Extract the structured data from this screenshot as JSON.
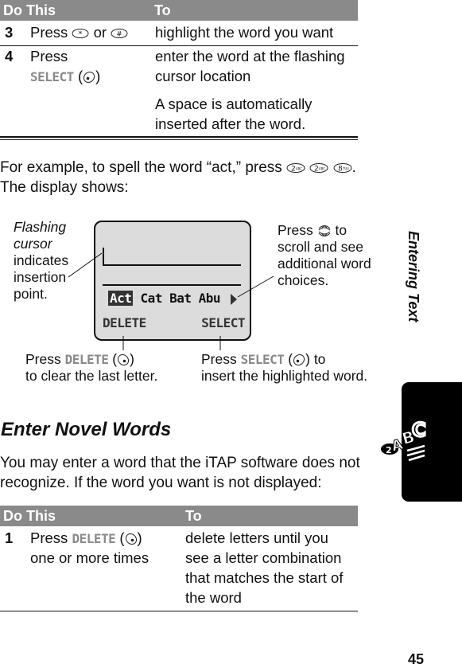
{
  "table1": {
    "header": {
      "col1": "Do This",
      "col2": "To"
    },
    "rows": [
      {
        "num": "3",
        "action_pre": "Press",
        "action_mid": "or",
        "key1_icon": "star-key-icon",
        "key2_icon": "pound-key-icon",
        "result": "highlight the word you want"
      },
      {
        "num": "4",
        "action_line1": "Press",
        "action_key": "SELECT",
        "key_icon": "select-softkey-icon",
        "result_line1": "enter the word at the flashing",
        "result_line2": "cursor location",
        "note_line1": "A space is automatically",
        "note_line2": "inserted after the word."
      }
    ]
  },
  "example": {
    "line1": "For example, to spell the word “act,” press",
    "keys": [
      "2abc",
      "2abc",
      "8tuv"
    ],
    "period": ".",
    "line2": "The display shows:"
  },
  "display": {
    "words": [
      "Act",
      "Cat",
      "Bat",
      "Abu"
    ],
    "selected_word": "Act",
    "left_softkey": "DELETE",
    "right_softkey": "SELECT",
    "more_arrow_icon": "right-triangle-icon"
  },
  "callouts": {
    "cursor": {
      "line1": "Flashing",
      "line2": "cursor",
      "line3": "indicates",
      "line4": "insertion",
      "line5": "point."
    },
    "scroll": {
      "pre": "Press",
      "post": "to",
      "line2": "scroll and see",
      "line3": "additional word",
      "line4": "choices."
    },
    "delete": {
      "pre": "Press",
      "key": "DELETE",
      "line2": "to clear the last letter."
    },
    "select": {
      "pre": "Press",
      "key": "SELECT",
      "post": "to",
      "line2": "insert the highlighted word."
    }
  },
  "section": {
    "title": "Enter Novel Words",
    "para_line1": "You may enter a word that the iTAP software does not",
    "para_line2": "recognize. If the word you want is not displayed:"
  },
  "table2": {
    "header": {
      "col1": "Do This",
      "col2": "To"
    },
    "rows": [
      {
        "num": "1",
        "action_pre": "Press",
        "action_key": "DELETE",
        "action_line2": "one or more times",
        "result_lines": [
          "delete letters until you",
          "see a letter combination",
          "that matches the start of",
          "the word"
        ]
      }
    ]
  },
  "sidebar": {
    "chapter": "Entering Text",
    "tab_icon": "abc-text-icon",
    "tab_label": "2ABC"
  },
  "page_number": "45"
}
